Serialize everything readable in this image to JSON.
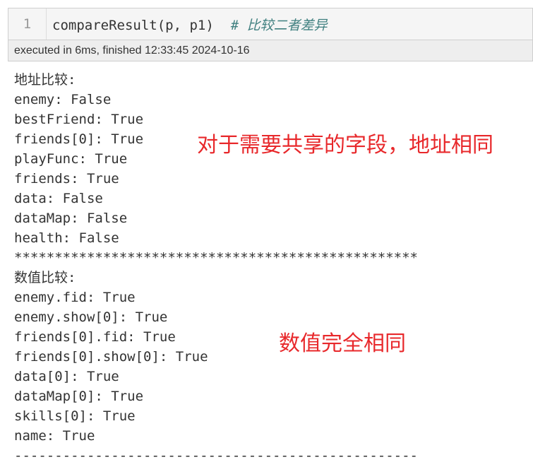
{
  "cell": {
    "line_number": "1",
    "code": "compareResult(p, p1)",
    "comment": "# 比较二者差异"
  },
  "exec_status": "executed in 6ms, finished 12:33:45 2024-10-16",
  "output_lines": [
    "地址比较:",
    "enemy: False",
    "bestFriend: True",
    "friends[0]: True",
    "playFunc: True",
    "friends: True",
    "data: False",
    "dataMap: False",
    "health: False",
    "**************************************************",
    "数值比较:",
    "enemy.fid: True",
    "enemy.show[0]: True",
    "friends[0].fid: True",
    "friends[0].show[0]: True",
    "data[0]: True",
    "dataMap[0]: True",
    "skills[0]: True",
    "name: True",
    "--------------------------------------------------"
  ],
  "annotations": {
    "address_note": "对于需要共享的字段，地址相同",
    "value_note": "数值完全相同",
    "color": "#e8282b"
  }
}
